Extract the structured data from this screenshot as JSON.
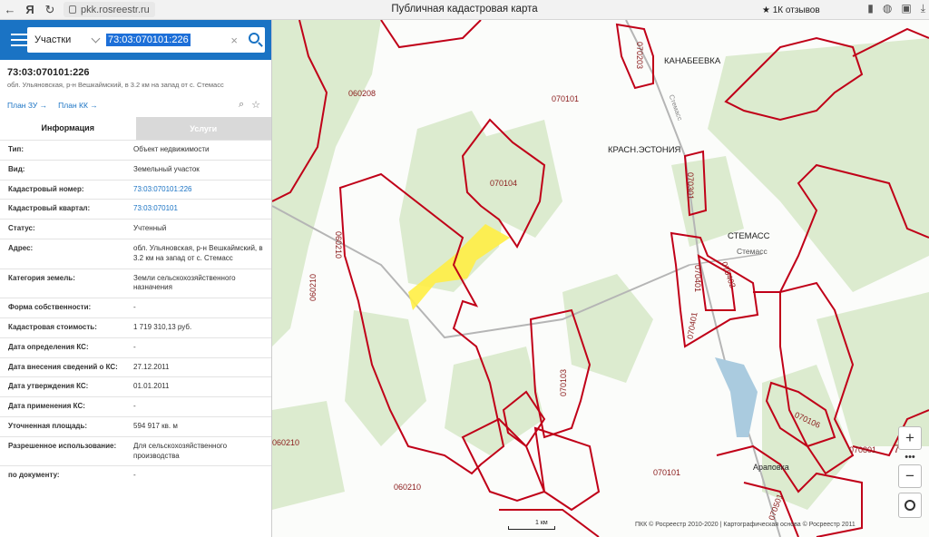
{
  "browser": {
    "back": "←",
    "brand": "Я",
    "reload": "↻",
    "url": "pkk.rosreestr.ru",
    "title": "Публичная кадастровая карта",
    "reviews": "★ 1К отзывов",
    "icons": [
      "bookmark-icon",
      "chat-icon",
      "extensions-icon",
      "download-icon"
    ]
  },
  "search": {
    "kind": "Участки",
    "query": "73:03:070101:226",
    "clear": "×"
  },
  "object": {
    "number": "73:03:070101:226",
    "address_short": "обл. Ульяновская, р-н Вешкаймский, в 3.2 км на запад от с. Стемасс",
    "plan_zu": "План ЗУ →",
    "plan_kk": "План КК →"
  },
  "tabs": [
    "Информация",
    "Услуги"
  ],
  "rows": [
    {
      "k": "Тип:",
      "v": "Объект недвижимости"
    },
    {
      "k": "Вид:",
      "v": "Земельный участок"
    },
    {
      "k": "Кадастровый номер:",
      "v": "73:03:070101:226",
      "link": true
    },
    {
      "k": "Кадастровый квартал:",
      "v": "73:03:070101",
      "link": true
    },
    {
      "k": "Статус:",
      "v": "Учтенный"
    },
    {
      "k": "Адрес:",
      "v": "обл. Ульяновская, р-н Вешкаймский, в 3.2 км на запад от с. Стемасс"
    },
    {
      "k": "Категория земель:",
      "v": "Земли сельскохозяйственного назначения"
    },
    {
      "k": "Форма собственности:",
      "v": "-"
    },
    {
      "k": "Кадастровая стоимость:",
      "v": "1 719 310,13 руб."
    },
    {
      "k": "Дата определения КС:",
      "v": "-"
    },
    {
      "k": "Дата внесения сведений о КС:",
      "v": "27.12.2011"
    },
    {
      "k": "Дата утверждения КС:",
      "v": "01.01.2011"
    },
    {
      "k": "Дата применения КС:",
      "v": "-"
    },
    {
      "k": "Уточненная площадь:",
      "v": "594 917 кв. м"
    },
    {
      "k": "Разрешенное использование:",
      "v": "Для сельскохозяйственного производства"
    },
    {
      "k": "по документу:",
      "v": "-"
    }
  ],
  "map_labels": {
    "kanabeevka": "КАНАБЕЕВКА",
    "krasn": "КРАСН.ЭСТОНИЯ",
    "stemass_caps": "СТЕМАСС",
    "stemass": "Стемасс",
    "arapovka": "Араповка",
    "road": "Стемасс",
    "q060208": "060208",
    "q070101a": "070101",
    "q070104": "070104",
    "q060210a": "060210",
    "q060210b": "060210",
    "q060210c": "060210",
    "q060210d": "060210",
    "q070101b": "070101",
    "q070103": "070103",
    "q070203": "070203",
    "q070301": "070301",
    "q070401": "070401",
    "q070402": "070402",
    "q070401b": "070401",
    "q070106": "070106",
    "q070801": "070801",
    "q070501": "070501",
    "q7": "7"
  },
  "map_controls": {
    "zoom_in": "+",
    "dots": "•••",
    "zoom_out": "−",
    "scale": "1 км",
    "footer": "ПКК © Росреестр 2010-2020 | Картографическая основа © Росреестр 2011"
  }
}
